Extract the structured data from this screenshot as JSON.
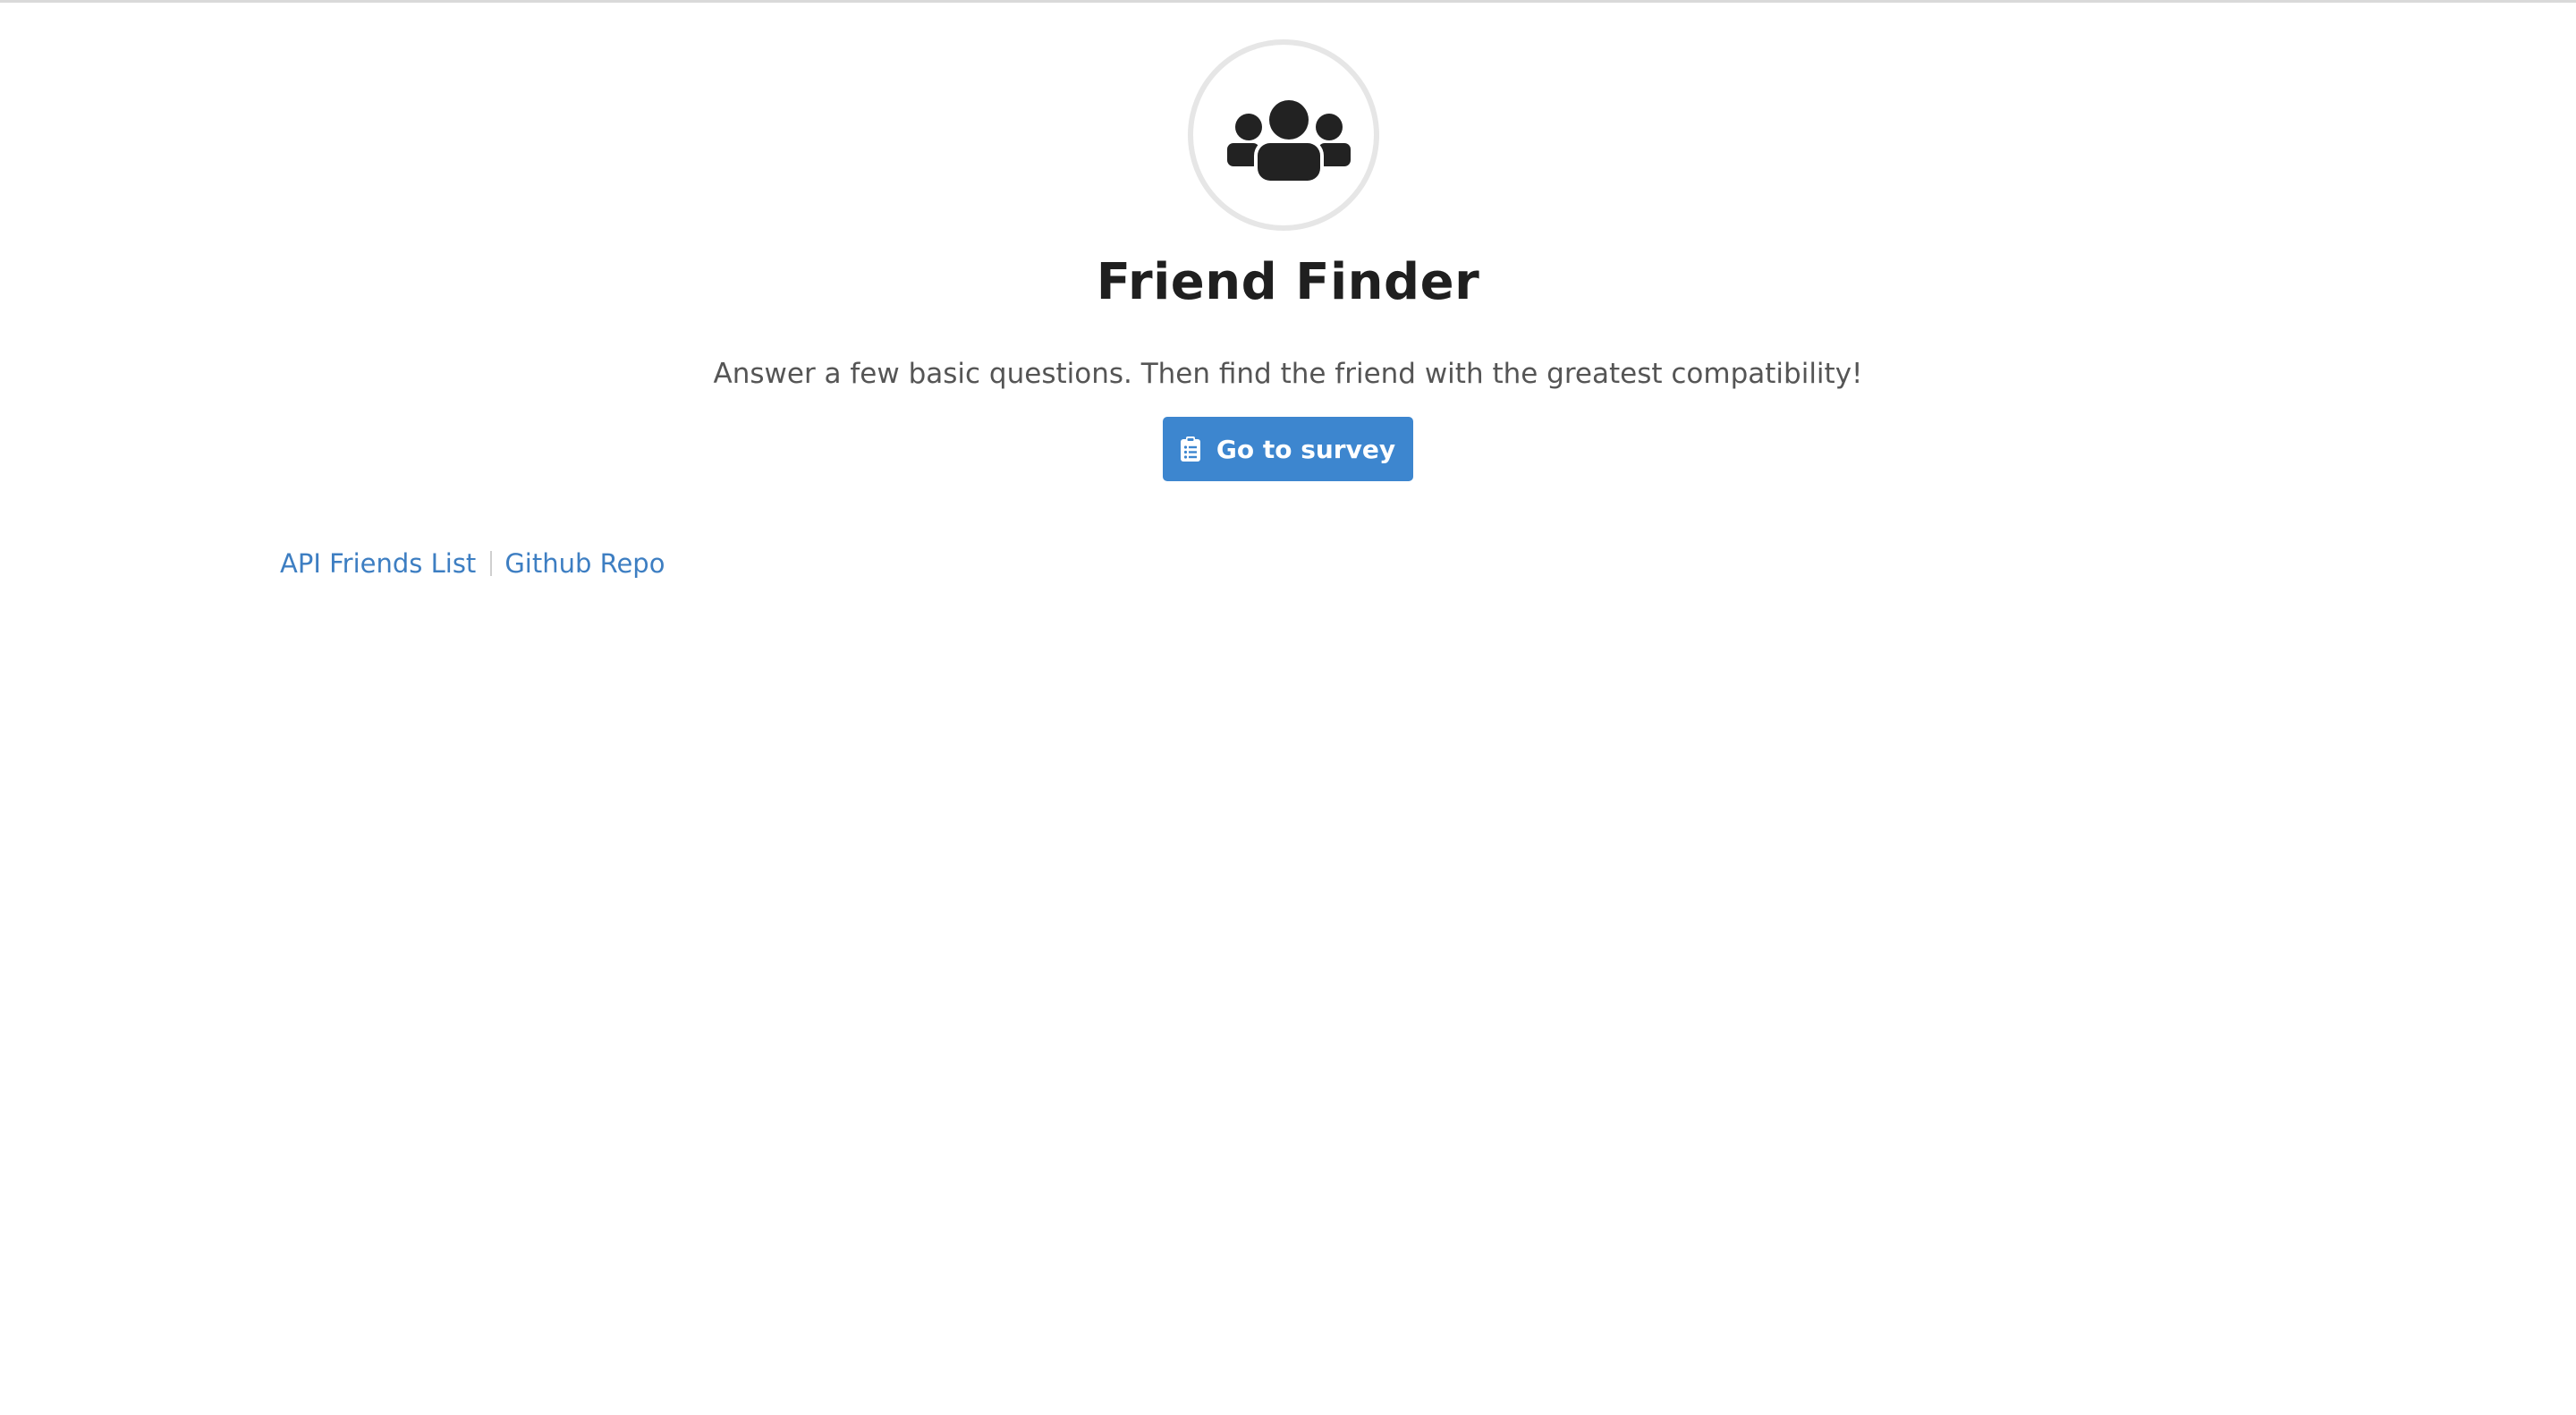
{
  "app": {
    "title": "Friend Finder",
    "tagline": "Answer a few basic questions. Then find the friend with the greatest compatibility!",
    "logo_icon": "users-icon",
    "accent_color": "#3d86cf",
    "link_color": "#3d7ec2"
  },
  "cta": {
    "label": "Go to survey",
    "icon": "clipboard-list-icon"
  },
  "footer": {
    "links": [
      {
        "label": "API Friends List"
      },
      {
        "label": "Github Repo"
      }
    ]
  }
}
